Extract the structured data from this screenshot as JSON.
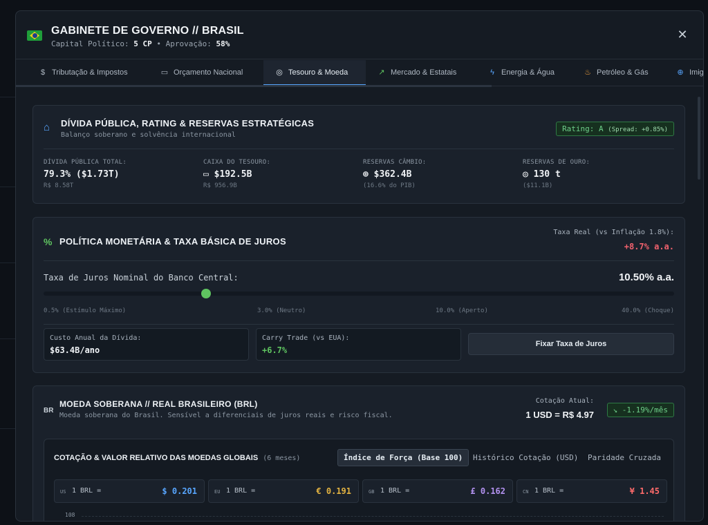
{
  "header": {
    "title": "GABINETE DE GOVERNO // BRASIL",
    "capital_label": "Capital Político:",
    "capital_value": "5 CP",
    "separator": "•",
    "approval_label": "Aprovação:",
    "approval_value": "58%",
    "close_icon": "close-icon",
    "close_glyph": "✕"
  },
  "tabs": [
    {
      "icon": "document-dollar-icon",
      "glyph": "$",
      "label": "Tributação & Impostos"
    },
    {
      "icon": "wallet-icon",
      "glyph": "▭",
      "label": "Orçamento Nacional"
    },
    {
      "icon": "coins-icon",
      "glyph": "◎",
      "label": "Tesouro & Moeda"
    },
    {
      "icon": "trend-up-icon",
      "glyph": "↗",
      "label": "Mercado & Estatais"
    },
    {
      "icon": "lightning-icon",
      "glyph": "ϟ",
      "label": "Energia & Água"
    },
    {
      "icon": "flame-icon",
      "glyph": "♨",
      "label": "Petróleo & Gás"
    },
    {
      "icon": "globe-icon",
      "glyph": "⊕",
      "label": "Imig"
    }
  ],
  "debt": {
    "icon": "bank-icon",
    "glyph": "⌂",
    "title": "DÍVIDA PÚBLICA, RATING & RESERVAS ESTRATÉGICAS",
    "subtitle": "Balanço soberano e solvência internacional",
    "rating_label": "Rating: A",
    "rating_spread": "(Spread: +0.85%)",
    "stats": [
      {
        "label": "DÍVIDA PÚBLICA TOTAL:",
        "icon": "",
        "glyph": "",
        "value": "79.3% ($1.73T)",
        "foot": "R$ 8.58T"
      },
      {
        "label": "CAIXA DO TESOURO:",
        "icon": "wallet-icon",
        "glyph": "▭",
        "value": "$192.5B",
        "foot": "R$ 956.9B"
      },
      {
        "label": "RESERVAS CÂMBIO:",
        "icon": "globe-icon",
        "glyph": "⊕",
        "value": "$362.4B",
        "foot": "(16.6% do PIB)"
      },
      {
        "label": "RESERVAS DE OURO:",
        "icon": "coins-icon",
        "glyph": "◎",
        "value": "130 t",
        "foot": "($11.1B)"
      }
    ]
  },
  "monetary": {
    "icon": "percent-icon",
    "glyph": "%",
    "title": "POLÍTICA MONETÁRIA & TAXA BÁSICA DE JUROS",
    "real_label": "Taxa Real (vs Inflação 1.8%):",
    "real_value": "+8.7% a.a.",
    "nominal_label": "Taxa de Juros Nominal do Banco Central:",
    "nominal_value": "10.50% a.a.",
    "slider_position": 0.258,
    "ticks": [
      "0.5% (Estímulo Máximo)",
      "3.0% (Neutro)",
      "10.0% (Aperto)",
      "40.0% (Choque)"
    ],
    "debt_cost_label": "Custo Anual da Dívida:",
    "debt_cost_value": "$63.4B/ano",
    "carry_label": "Carry Trade (vs EUA):",
    "carry_value": "+6.7%",
    "button_label": "Fixar Taxa de Juros"
  },
  "currency": {
    "code": "BR",
    "title": "MOEDA SOBERANA // REAL BRASILEIRO (BRL)",
    "subtitle": "Moeda soberana do Brasil. Sensível a diferenciais de juros reais e risco fiscal.",
    "quote_label": "Cotação Atual:",
    "quote_value": "1 USD = R$ 4.97",
    "trend_icon": "trend-down-icon",
    "trend_glyph": "↘",
    "trend_value": "-1.19%/mês",
    "panel_title": "COTAÇÃO & VALOR RELATIVO DAS MOEDAS GLOBAIS",
    "panel_period": "(6 meses)",
    "segments": [
      "Índice de Força (Base 100)",
      "Histórico Cotação (USD)",
      "Paridade Cruzada"
    ],
    "rates": [
      {
        "code": "US",
        "label": "1 BRL =",
        "value": "$ 0.201",
        "color": "#58a6ff"
      },
      {
        "code": "EU",
        "label": "1 BRL =",
        "value": "€ 0.191",
        "color": "#e3b341"
      },
      {
        "code": "GB",
        "label": "1 BRL =",
        "value": "£ 0.162",
        "color": "#b392f0"
      },
      {
        "code": "CN",
        "label": "1 BRL =",
        "value": "¥ 1.45",
        "color": "#ff6b6b"
      }
    ],
    "chart_top_tick": "108"
  },
  "colors": {
    "accent": "#58a6ff",
    "positive": "#5fc460",
    "negative": "#f0616d"
  }
}
